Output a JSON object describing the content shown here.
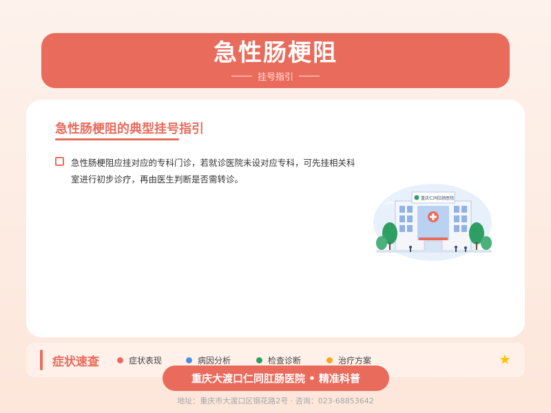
{
  "header": {
    "title": "急性肠梗阻",
    "subtitle": "挂号指引"
  },
  "card": {
    "title": "急性肠梗阻的典型挂号指引",
    "content": "急性肠梗阻应挂对应的专科门诊，若就诊医院未设对应专科，可先挂相关科室进行初步诊疗，再由医生判断是否需转诊。",
    "illustration": {
      "sign_text": "重庆仁同肛肠医院",
      "icon": "hospital-icon"
    }
  },
  "symptoms": {
    "title": "症状速查",
    "tags": [
      {
        "label": "症状表现",
        "color": "#e96b5c"
      },
      {
        "label": "病因分析",
        "color": "#4a8fe7"
      },
      {
        "label": "检查诊断",
        "color": "#2e9e63"
      },
      {
        "label": "治疗方案",
        "color": "#f5a623"
      }
    ],
    "star_icon": "star-icon"
  },
  "brand": "重庆大渡口仁同肛肠医院 • 精准科普",
  "footer": "地址：重庆市大渡口区钢花路2号 · 咨询：023-68853642",
  "colors": {
    "accent": "#e96b5c",
    "background": "#fdf2ec",
    "star": "#ffc400"
  }
}
